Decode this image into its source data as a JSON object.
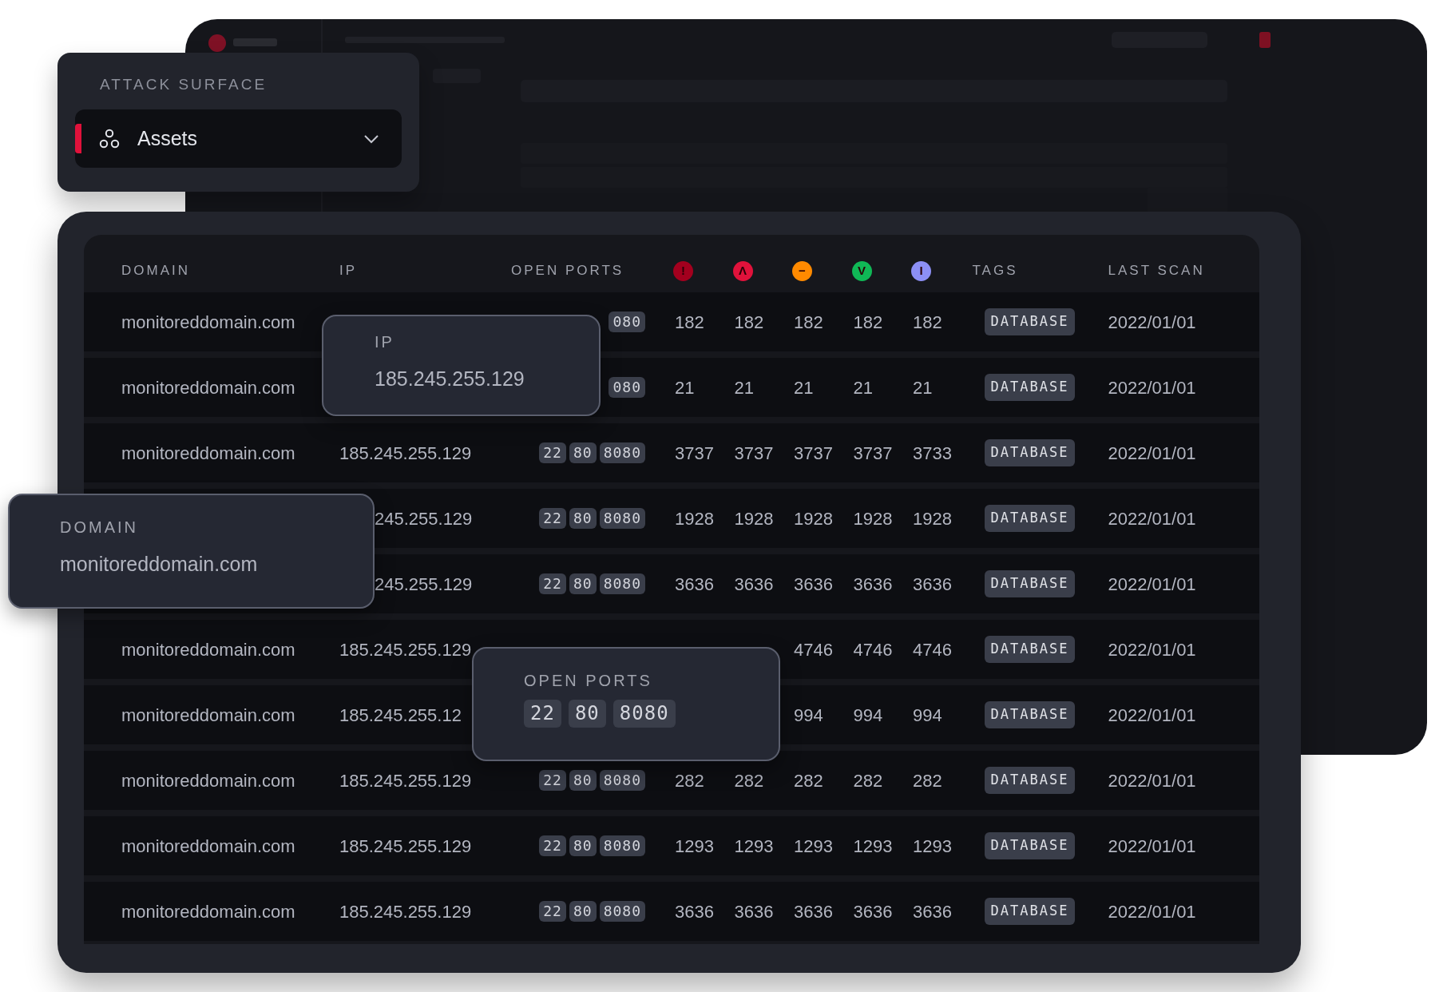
{
  "sidebar_card": {
    "section_label": "ATTACK SURFACE",
    "item": {
      "label": "Assets",
      "selected": true
    }
  },
  "table": {
    "columns": [
      {
        "kind": "text",
        "label": "DOMAIN"
      },
      {
        "kind": "text",
        "label": "IP"
      },
      {
        "kind": "text",
        "label": "OPEN PORTS"
      },
      {
        "kind": "severity",
        "symbol": "!",
        "color": "#a3001e"
      },
      {
        "kind": "severity",
        "symbol": "Λ",
        "color": "#e0123b"
      },
      {
        "kind": "severity",
        "symbol": "−",
        "color": "#ff8a00"
      },
      {
        "kind": "severity",
        "symbol": "V",
        "color": "#10b856"
      },
      {
        "kind": "severity",
        "symbol": "I",
        "color": "#8c8ff5"
      },
      {
        "kind": "text",
        "label": "TAGS"
      },
      {
        "kind": "text",
        "label": "LAST SCAN"
      }
    ],
    "rows": [
      {
        "domain": "monitoreddomain.com",
        "ports": [
          "080"
        ],
        "counts": [
          "182",
          "182",
          "182",
          "182",
          "182"
        ],
        "tag": "DATABASE",
        "last_scan": "2022/01/01"
      },
      {
        "domain": "monitoreddomain.com",
        "ports": [
          "080"
        ],
        "counts": [
          "21",
          "21",
          "21",
          "21",
          "21"
        ],
        "tag": "DATABASE",
        "last_scan": "2022/01/01"
      },
      {
        "domain": "monitoreddomain.com",
        "ip": "185.245.255.129",
        "ports": [
          "22",
          "80",
          "8080"
        ],
        "counts": [
          "3737",
          "3737",
          "3737",
          "3737",
          "3733"
        ],
        "tag": "DATABASE",
        "last_scan": "2022/01/01"
      },
      {
        "ip": "245.255.129",
        "ports": [
          "22",
          "80",
          "8080"
        ],
        "counts": [
          "1928",
          "1928",
          "1928",
          "1928",
          "1928"
        ],
        "tag": "DATABASE",
        "last_scan": "2022/01/01"
      },
      {
        "ip": "245.255.129",
        "ports": [
          "22",
          "80",
          "8080"
        ],
        "counts": [
          "3636",
          "3636",
          "3636",
          "3636",
          "3636"
        ],
        "tag": "DATABASE",
        "last_scan": "2022/01/01"
      },
      {
        "domain": "monitoreddomain.com",
        "ip": "185.245.255.129",
        "counts": [
          "4746",
          "4746",
          "4746"
        ],
        "tag": "DATABASE",
        "last_scan": "2022/01/01"
      },
      {
        "domain": "monitoreddomain.com",
        "ip": "185.245.255.12",
        "counts": [
          "994",
          "994",
          "994"
        ],
        "tag": "DATABASE",
        "last_scan": "2022/01/01"
      },
      {
        "domain": "monitoreddomain.com",
        "ip": "185.245.255.129",
        "ports": [
          "22",
          "80",
          "8080"
        ],
        "counts": [
          "282",
          "282",
          "282",
          "282",
          "282"
        ],
        "tag": "DATABASE",
        "last_scan": "2022/01/01"
      },
      {
        "domain": "monitoreddomain.com",
        "ip": "185.245.255.129",
        "ports": [
          "22",
          "80",
          "8080"
        ],
        "counts": [
          "1293",
          "1293",
          "1293",
          "1293",
          "1293"
        ],
        "tag": "DATABASE",
        "last_scan": "2022/01/01"
      },
      {
        "domain": "monitoreddomain.com",
        "ip": "185.245.255.129",
        "ports": [
          "22",
          "80",
          "8080"
        ],
        "counts": [
          "3636",
          "3636",
          "3636",
          "3636",
          "3636"
        ],
        "tag": "DATABASE",
        "last_scan": "2022/01/01"
      }
    ]
  },
  "tooltips": [
    {
      "label": "IP",
      "value": "185.245.255.129"
    },
    {
      "label": "DOMAIN",
      "value": "monitoreddomain.com"
    },
    {
      "label": "OPEN PORTS",
      "ports": [
        "22",
        "80",
        "8080"
      ]
    }
  ]
}
